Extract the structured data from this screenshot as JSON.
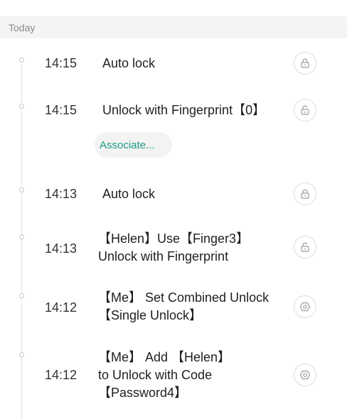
{
  "section": {
    "label": "Today"
  },
  "associate_label": "Associate...",
  "colors": {
    "accent": "#1a9b86",
    "header_bg": "#f4f4f4",
    "icon": "#9a9a9a"
  },
  "events": [
    {
      "time": "14:15",
      "lines": [
        "Auto lock"
      ],
      "icon": "lock-closed-icon"
    },
    {
      "time": "14:15",
      "lines": [
        "Unlock with Fingerprint【0】"
      ],
      "icon": "lock-open-icon"
    },
    {
      "time": "14:13",
      "lines": [
        "Auto lock"
      ],
      "icon": "lock-closed-icon"
    },
    {
      "time": "14:13",
      "lines": [
        "【Helen】Use【Finger3】",
        "Unlock with Fingerprint"
      ],
      "icon": "lock-open-icon"
    },
    {
      "time": "14:12",
      "lines": [
        "【Me】 Set Combined Unlock",
        "【Single Unlock】"
      ],
      "icon": "settings-hexagon-icon"
    },
    {
      "time": "14:12",
      "lines": [
        "【Me】 Add 【Helen】",
        "to Unlock with Code",
        "【Password4】"
      ],
      "icon": "settings-hexagon-icon"
    }
  ]
}
